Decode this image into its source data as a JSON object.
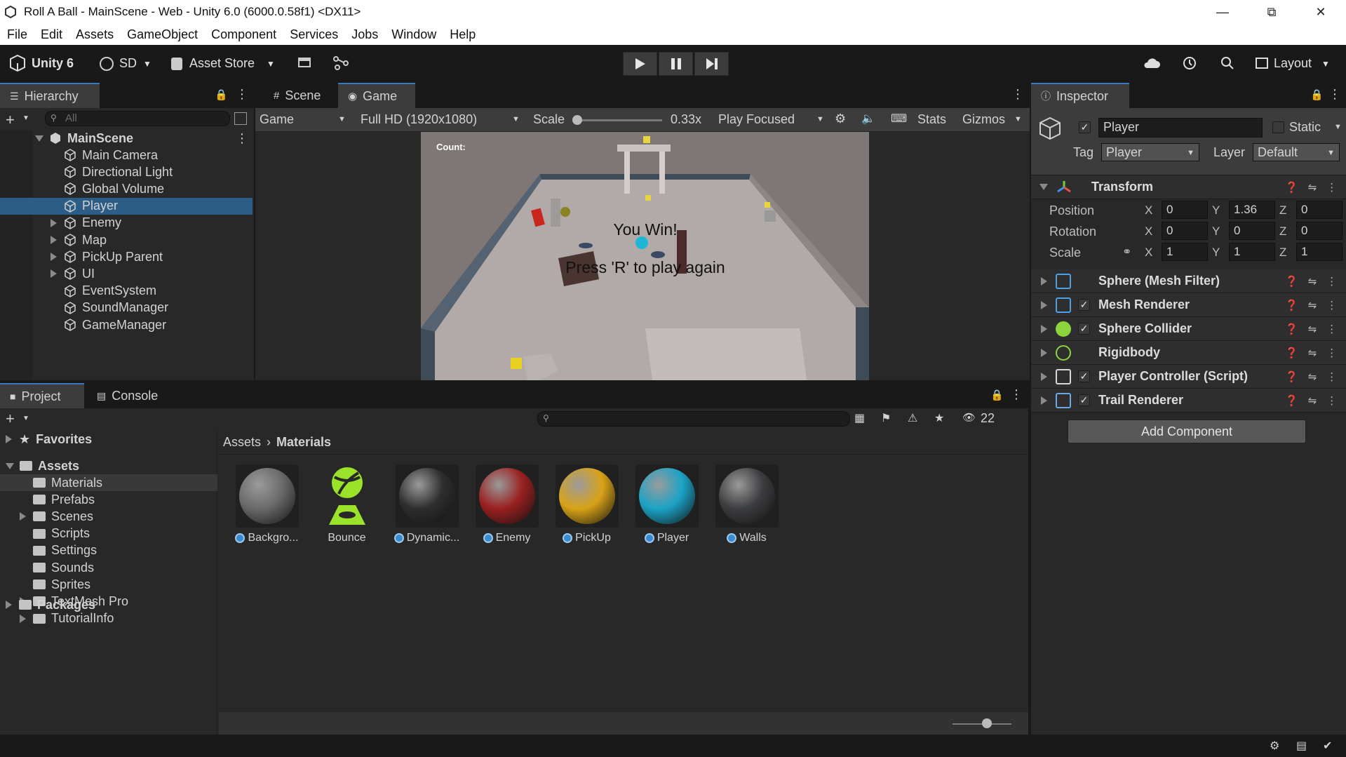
{
  "window": {
    "title": "Roll A Ball - MainScene - Web - Unity 6.0 (6000.0.58f1) <DX11>"
  },
  "menu": [
    "File",
    "Edit",
    "Assets",
    "GameObject",
    "Component",
    "Services",
    "Jobs",
    "Window",
    "Help"
  ],
  "toolbar": {
    "unity_label": "Unity 6",
    "account": "SD",
    "asset_store": "Asset Store",
    "layout": "Layout"
  },
  "hierarchy": {
    "tab": "Hierarchy",
    "search_placeholder": "All",
    "scene": "MainScene",
    "items": [
      {
        "label": "Main Camera",
        "expandable": false
      },
      {
        "label": "Directional Light",
        "expandable": false
      },
      {
        "label": "Global Volume",
        "expandable": false
      },
      {
        "label": "Player",
        "expandable": false,
        "selected": true
      },
      {
        "label": "Enemy",
        "expandable": true
      },
      {
        "label": "Map",
        "expandable": true
      },
      {
        "label": "PickUp Parent",
        "expandable": true
      },
      {
        "label": "UI",
        "expandable": true
      },
      {
        "label": "EventSystem",
        "expandable": false
      },
      {
        "label": "SoundManager",
        "expandable": false
      },
      {
        "label": "GameManager",
        "expandable": false
      }
    ]
  },
  "game_view": {
    "tab_scene": "Scene",
    "tab_game": "Game",
    "display": "Game",
    "resolution": "Full HD (1920x1080)",
    "scale_label": "Scale",
    "scale_value": "0.33x",
    "play_mode": "Play Focused",
    "stats": "Stats",
    "gizmos": "Gizmos",
    "hud_count": "Count:",
    "win_text": "You Win!",
    "restart_text": "Press 'R' to play again"
  },
  "inspector": {
    "tab": "Inspector",
    "object_name": "Player",
    "static_label": "Static",
    "tag_label": "Tag",
    "tag_value": "Player",
    "layer_label": "Layer",
    "layer_value": "Default",
    "transform": {
      "title": "Transform",
      "position": {
        "label": "Position",
        "x": "0",
        "y": "1.36",
        "z": "0"
      },
      "rotation": {
        "label": "Rotation",
        "x": "0",
        "y": "0",
        "z": "0"
      },
      "scale": {
        "label": "Scale",
        "x": "1",
        "y": "1",
        "z": "1"
      }
    },
    "components": [
      {
        "title": "Sphere (Mesh Filter)",
        "checkbox": false,
        "icon": "mesh-filter-icon"
      },
      {
        "title": "Mesh Renderer",
        "checkbox": true,
        "icon": "mesh-renderer-icon"
      },
      {
        "title": "Sphere Collider",
        "checkbox": true,
        "icon": "sphere-collider-icon"
      },
      {
        "title": "Rigidbody",
        "checkbox": false,
        "icon": "rigidbody-icon"
      },
      {
        "title": "Player Controller (Script)",
        "checkbox": true,
        "icon": "script-icon"
      },
      {
        "title": "Trail Renderer",
        "checkbox": true,
        "icon": "trail-renderer-icon"
      }
    ],
    "add_component": "Add Component"
  },
  "project": {
    "tab_project": "Project",
    "tab_console": "Console",
    "hidden_count": "22",
    "favorites": "Favorites",
    "assets_root": "Assets",
    "folders": [
      {
        "label": "Materials",
        "expandable": false,
        "selected": true
      },
      {
        "label": "Prefabs",
        "expandable": false
      },
      {
        "label": "Scenes",
        "expandable": true
      },
      {
        "label": "Scripts",
        "expandable": false
      },
      {
        "label": "Settings",
        "expandable": false
      },
      {
        "label": "Sounds",
        "expandable": false
      },
      {
        "label": "Sprites",
        "expandable": false
      },
      {
        "label": "TextMesh Pro",
        "expandable": true
      },
      {
        "label": "TutorialInfo",
        "expandable": true
      }
    ],
    "packages": "Packages",
    "breadcrumb": [
      "Assets",
      "Materials"
    ],
    "assets": [
      {
        "label": "Backgro...",
        "color": "#6a6a6a"
      },
      {
        "label": "Bounce",
        "color": "#9be22a"
      },
      {
        "label": "Dynamic...",
        "color": "#2e2e30"
      },
      {
        "label": "Enemy",
        "color": "#9a2020"
      },
      {
        "label": "PickUp",
        "color": "#d9a317"
      },
      {
        "label": "Player",
        "color": "#1ba3c6"
      },
      {
        "label": "Walls",
        "color": "#3c3d3f"
      }
    ]
  },
  "colors": {
    "accent": "#3a79bb",
    "selection": "#2c5d87",
    "panel": "#282828"
  }
}
